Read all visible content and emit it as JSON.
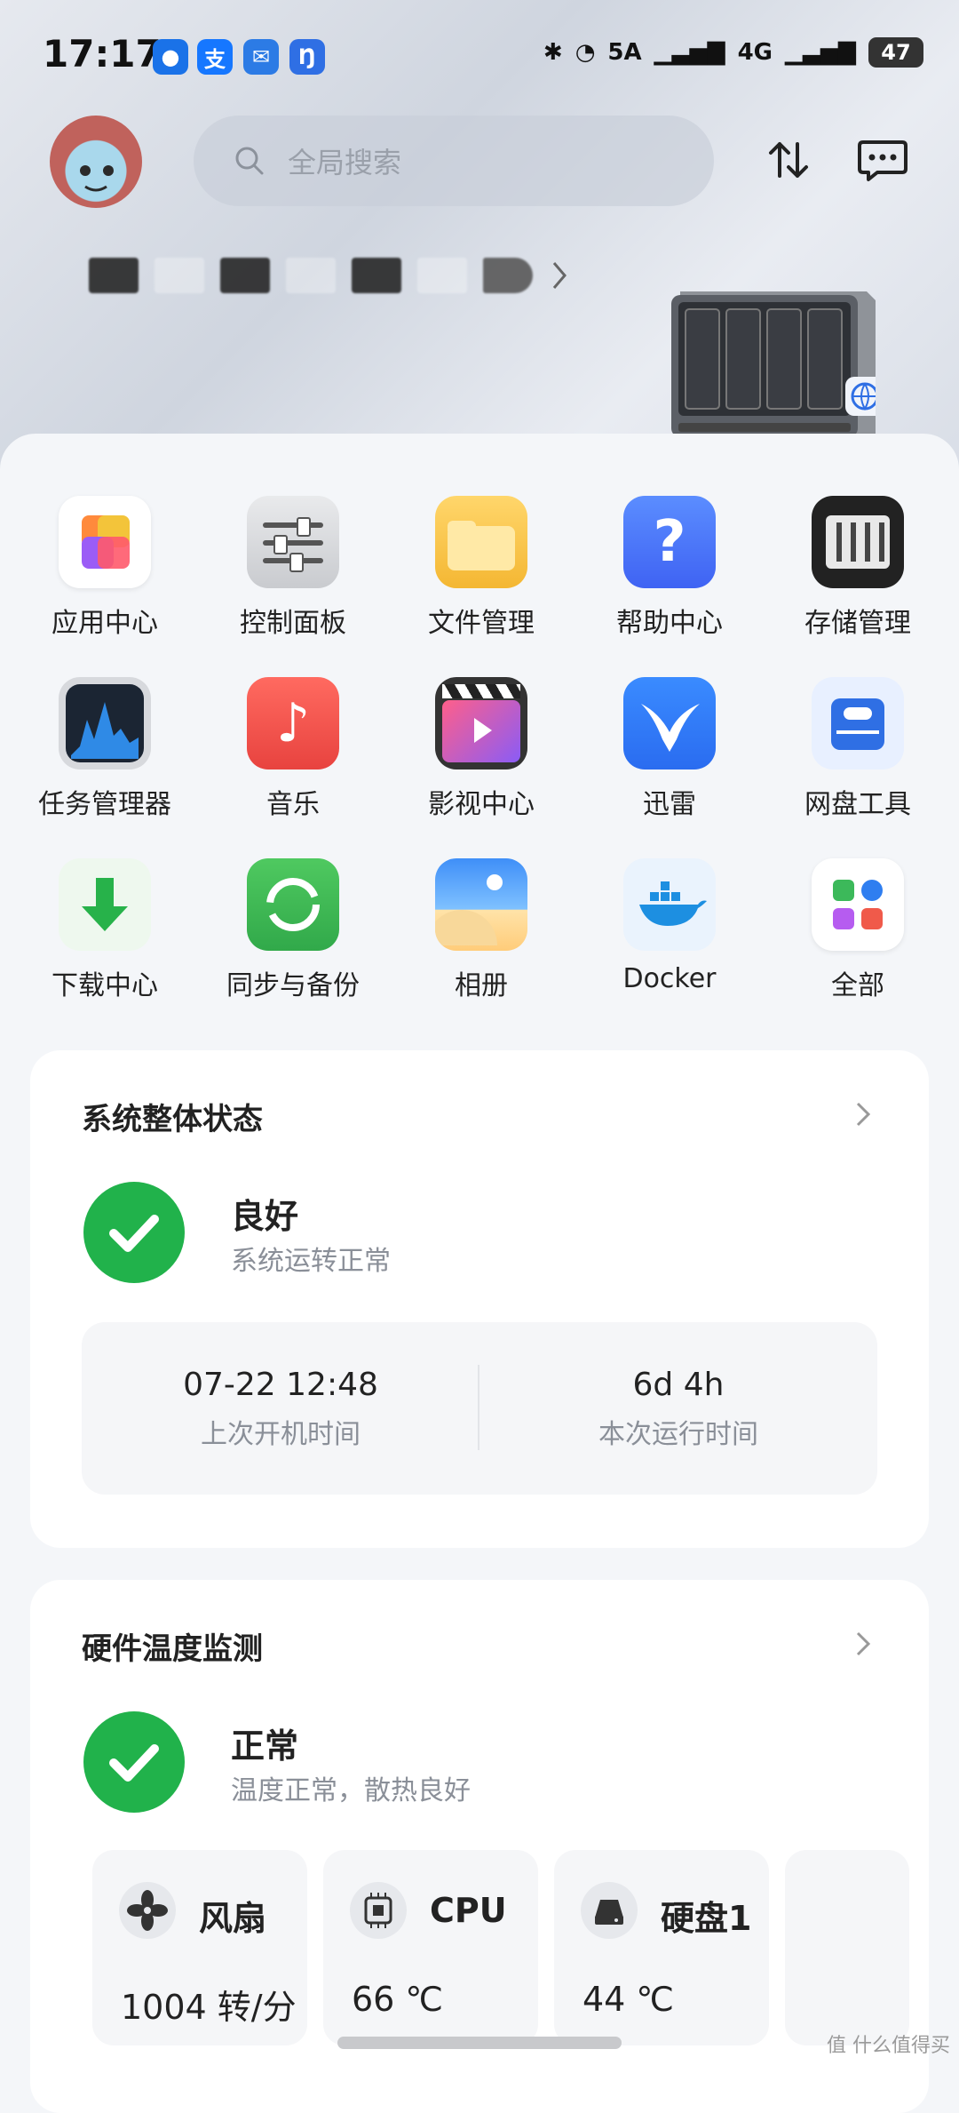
{
  "status_bar": {
    "time": "17:17",
    "network_5a": "5A",
    "network_4g": "4G",
    "battery": "47"
  },
  "header": {
    "search_placeholder": "全局搜索"
  },
  "apps": [
    {
      "label": "应用中心",
      "icon": "app-center-icon"
    },
    {
      "label": "控制面板",
      "icon": "control-panel-icon"
    },
    {
      "label": "文件管理",
      "icon": "folder-icon"
    },
    {
      "label": "帮助中心",
      "icon": "help-icon"
    },
    {
      "label": "存储管理",
      "icon": "storage-icon"
    },
    {
      "label": "任务管理器",
      "icon": "task-manager-icon"
    },
    {
      "label": "音乐",
      "icon": "music-icon"
    },
    {
      "label": "影视中心",
      "icon": "video-icon"
    },
    {
      "label": "迅雷",
      "icon": "xunlei-icon"
    },
    {
      "label": "网盘工具",
      "icon": "cloud-drive-icon"
    },
    {
      "label": "下载中心",
      "icon": "download-icon"
    },
    {
      "label": "同步与备份",
      "icon": "sync-icon"
    },
    {
      "label": "相册",
      "icon": "photos-icon"
    },
    {
      "label": "Docker",
      "icon": "docker-icon"
    },
    {
      "label": "全部",
      "icon": "all-apps-icon"
    }
  ],
  "system_status": {
    "title": "系统整体状态",
    "state": "良好",
    "state_desc": "系统运转正常",
    "boot_time": "07-22 12:48",
    "boot_time_label": "上次开机时间",
    "uptime": "6d 4h",
    "uptime_label": "本次运行时间"
  },
  "hardware_temp": {
    "title": "硬件温度监测",
    "state": "正常",
    "state_desc": "温度正常，散热良好",
    "sensors": [
      {
        "name": "风扇",
        "value": "1004 转/分",
        "icon": "fan-icon"
      },
      {
        "name": "CPU",
        "value": "66 ℃",
        "icon": "cpu-icon"
      },
      {
        "name": "硬盘1",
        "value": "44 ℃",
        "icon": "disk-icon"
      }
    ]
  },
  "watermark": "值 什么值得买",
  "colors": {
    "accent_green": "#21b24b",
    "card_bg": "#ffffff",
    "page_bg": "#f4f6f9"
  }
}
